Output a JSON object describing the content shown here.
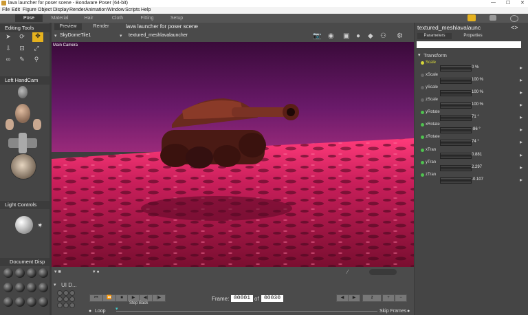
{
  "window": {
    "title": "lava launcher for poser scene - Bondware Poser (64-bit)",
    "min": "—",
    "max": "☐",
    "close": "✕"
  },
  "menu": [
    "File",
    "Edit",
    "Figure",
    "Object",
    "Display",
    "Render",
    "Animation",
    "Window",
    "Scripts",
    "Help"
  ],
  "rooms": [
    "Pose",
    "Material",
    "Hair",
    "Cloth",
    "Fitting",
    "Setup"
  ],
  "left": {
    "editing_tools": "Editing Tools",
    "left_handcam": "Left HandCam",
    "light_controls": "Light Controls",
    "document_disp": "Document  Disp"
  },
  "doc": {
    "tab_preview": "Preview",
    "tab_render": "Render",
    "scene_title": "lava launcher for poser scene",
    "dome": "SkyDomeTile1",
    "mesh": "textured_meshlavalauncher",
    "camera": "Main Camera"
  },
  "right": {
    "object_name": "textured_meshlavalaunc",
    "tab_parameters": "Parameters",
    "tab_properties": "Properties",
    "section": "Transform",
    "params": [
      {
        "name": "Scale",
        "value": "0 %",
        "color": "#d6d63a"
      },
      {
        "name": "xScale",
        "value": "100 %",
        "color": "#666"
      },
      {
        "name": "yScale",
        "value": "100 %",
        "color": "#666"
      },
      {
        "name": "zScale",
        "value": "100 %",
        "color": "#666"
      },
      {
        "name": "yRotate",
        "value": "71 °",
        "color": "#4fc24f"
      },
      {
        "name": "xRotate",
        "value": "-86 °",
        "color": "#4fc24f"
      },
      {
        "name": "zRotate",
        "value": "74 °",
        "color": "#4fc24f"
      },
      {
        "name": "xTran",
        "value": "0.881",
        "color": "#4fc24f"
      },
      {
        "name": "yTran",
        "value": "2.297",
        "color": "#4fc24f"
      },
      {
        "name": "zTran",
        "value": "-0.107",
        "color": "#4fc24f"
      }
    ]
  },
  "anim": {
    "ui_label": "UI D...",
    "step_back": "Step Back",
    "frame_label": "Frame:",
    "frame_value": "00001",
    "of_label": "of",
    "frame_total": "00030",
    "loop": "Loop",
    "skip_frames": "Skip Frames"
  }
}
